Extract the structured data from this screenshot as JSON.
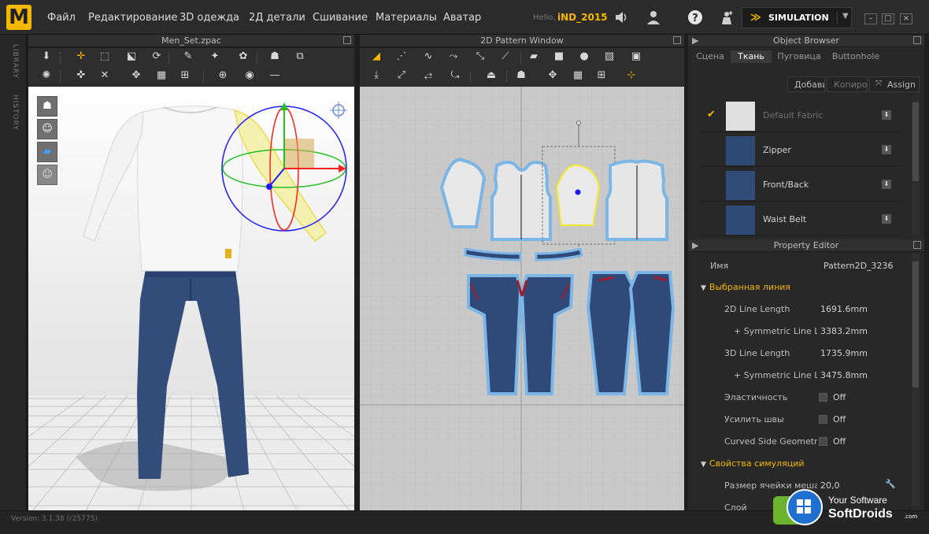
{
  "menu": {
    "items": [
      "Файл",
      "Редактирование",
      "3D одежда",
      "2Д детали",
      "Сшивание",
      "Материалы",
      "Аватар"
    ],
    "greeting": "Hello,",
    "username": "iND_2015",
    "simulation_label": "SIMULATION"
  },
  "side_tabs": [
    "LIBRARY",
    "HISTORY"
  ],
  "panels": {
    "view3d_title": "Men_Set.zpac",
    "view2d_title": "2D Pattern Window"
  },
  "object_browser": {
    "title": "Object Browser",
    "tabs": [
      "Сцена",
      "Ткань",
      "Пуговица",
      "Buttonhole"
    ],
    "active_tab": "Ткань",
    "buttons": {
      "add": "Добавить",
      "copy": "Копировать",
      "assign": "Assign"
    },
    "fabrics": [
      {
        "name": "Default Fabric",
        "selected": true,
        "swatch": "#e0e0e0"
      },
      {
        "name": "Zipper",
        "selected": false,
        "swatch": "#2d4a75"
      },
      {
        "name": "Front/Back",
        "selected": false,
        "swatch": "#2f4d78"
      },
      {
        "name": "Waist Belt",
        "selected": false,
        "swatch": "#2e4b77"
      }
    ]
  },
  "property_editor": {
    "title": "Property Editor",
    "name_label": "Имя",
    "name_value": "Pattern2D_3236",
    "sections": [
      {
        "title": "Выбранная линия",
        "rows": [
          {
            "label": "2D Line Length",
            "value": "1691.6mm",
            "type": "text"
          },
          {
            "label": "+ Symmetric Line Length",
            "value": "3383.2mm",
            "type": "text"
          },
          {
            "label": "3D Line Length",
            "value": "1735.9mm",
            "type": "text"
          },
          {
            "label": "+ Symmetric Line Length",
            "value": "3475.8mm",
            "type": "text"
          },
          {
            "label": "Эластичность",
            "value": "Off",
            "type": "check"
          },
          {
            "label": "Усилить швы",
            "value": "Off",
            "type": "check"
          },
          {
            "label": "Curved Side Geometry",
            "value": "Off",
            "type": "check"
          }
        ]
      },
      {
        "title": "Свойства симуляций",
        "rows": [
          {
            "label": "Размер ячейки меша",
            "value": "20,0",
            "type": "text"
          },
          {
            "label": "Слой",
            "value": "",
            "type": "text"
          }
        ]
      }
    ]
  },
  "status": {
    "version": "Version: 3.1.38   (r25775)"
  },
  "watermark": {
    "line1": "Your Software",
    "line2": "SoftDroids",
    "suffix": ".com"
  },
  "colors": {
    "accent": "#f5b800",
    "pattern_outline": "#7cb6e6",
    "denim": "#2f4a78",
    "selected_sleeve": "#f4f0b0",
    "selection_line": "#f2ea2a"
  }
}
